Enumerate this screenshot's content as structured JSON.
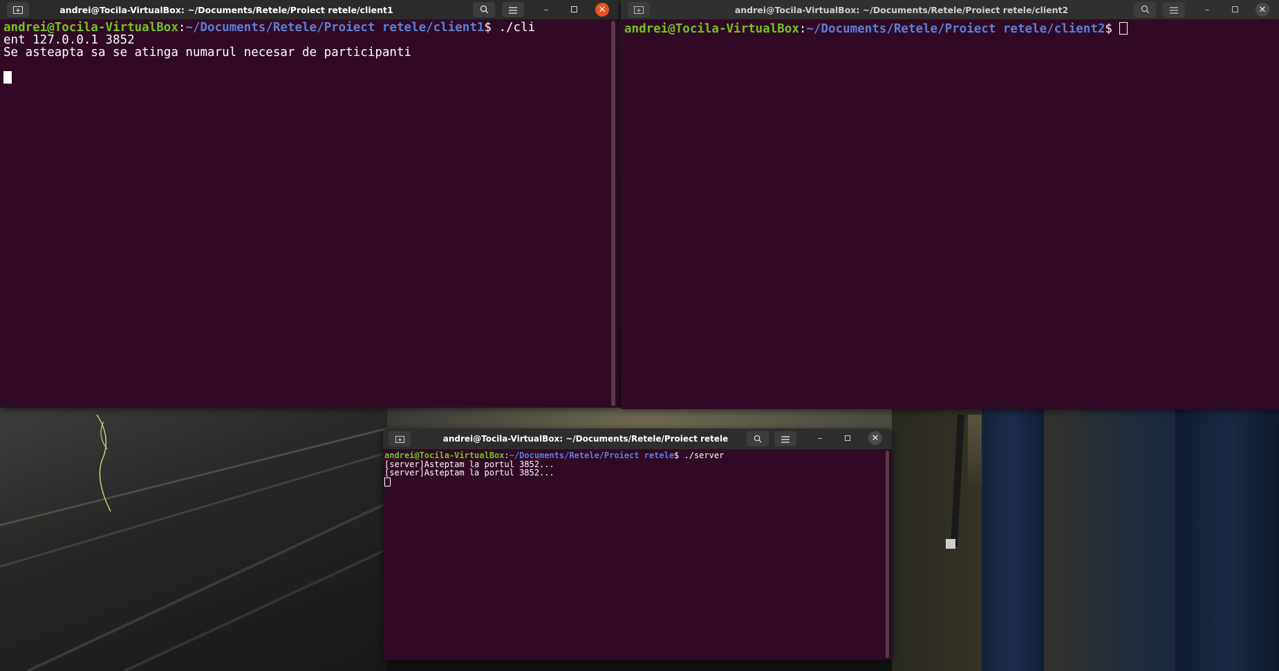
{
  "windows": {
    "client1": {
      "title": "andrei@Tocila-VirtualBox: ~/Documents/Retele/Proiect retele/client1",
      "prompt_user": "andrei@Tocila-VirtualBox",
      "prompt_sep": ":",
      "prompt_path": "~/Documents/Retele/Proiect retele/client1",
      "prompt_symbol": "$ ",
      "command_part1": "./cli",
      "command_part2": "ent 127.0.0.1 3852",
      "output_line": "Se asteapta sa se atinga numarul necesar de participanti"
    },
    "client2": {
      "title": "andrei@Tocila-VirtualBox: ~/Documents/Retele/Proiect retele/client2",
      "prompt_user": "andrei@Tocila-VirtualBox",
      "prompt_sep": ":",
      "prompt_path": "~/Documents/Retele/Proiect retele/client2",
      "prompt_symbol": "$ "
    },
    "server": {
      "title": "andrei@Tocila-VirtualBox: ~/Documents/Retele/Proiect retele",
      "prompt_user": "andrei@Tocila-VirtualBox",
      "prompt_sep": ":",
      "prompt_path": "~/Documents/Retele/Proiect retele",
      "prompt_symbol": "$ ",
      "command": "./server",
      "output_lines": [
        "[server]Asteptam la portul 3852...",
        "[server]Asteptam la portul 3852..."
      ]
    }
  },
  "icons": {
    "new_tab": "new-tab-icon",
    "search": "search-icon",
    "menu": "hamburger-menu-icon",
    "minimize": "minimize-icon",
    "maximize": "maximize-icon",
    "close": "close-icon"
  },
  "colors": {
    "terminal_bg": "#300a24",
    "prompt_user": "#73c41b",
    "prompt_path": "#5b7fd6",
    "close_active": "#e95420"
  }
}
